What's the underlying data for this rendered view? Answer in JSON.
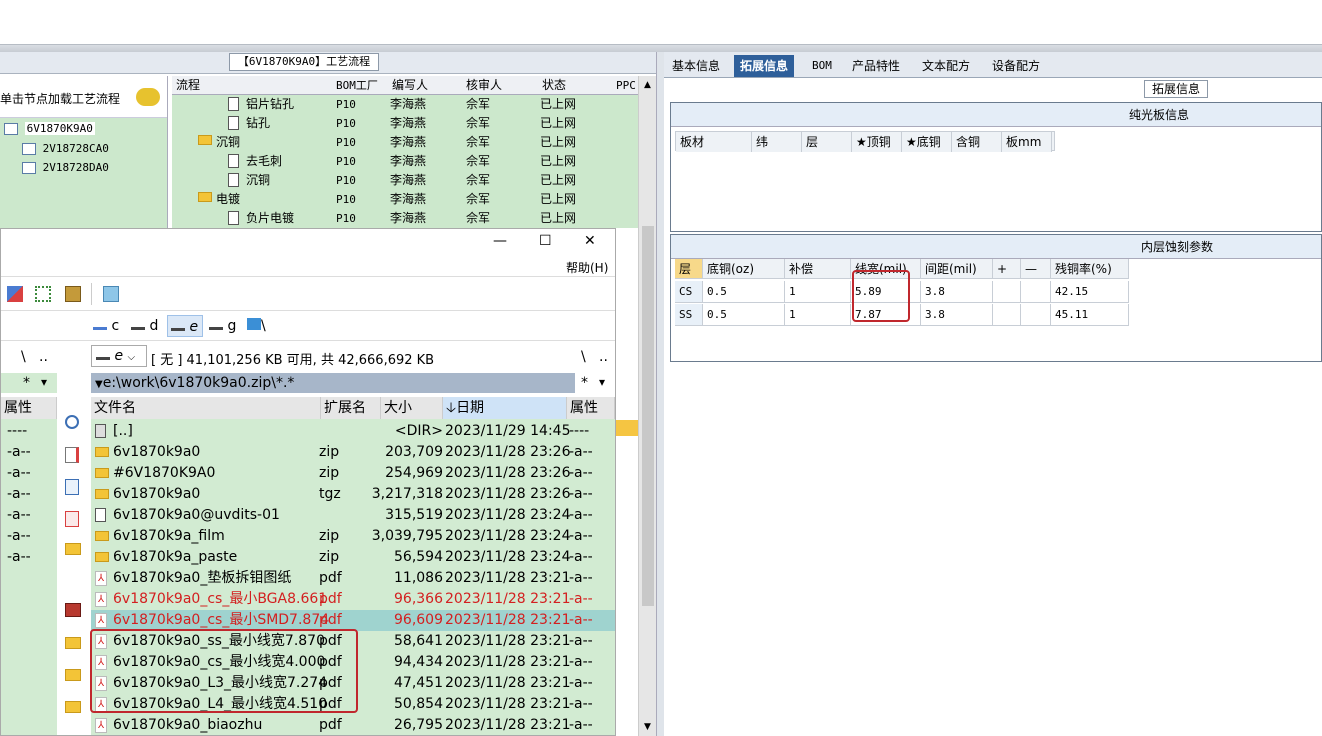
{
  "top_window": {
    "title": "【6V1870K9A0】工艺流程",
    "left_tree": {
      "hint": "单击节点加载工艺流程",
      "nodes": [
        "6V1870K9A0",
        "2V18728CA0",
        "2V18728DA0"
      ]
    },
    "process_headers": [
      "流程",
      "BOM工厂",
      "编写人",
      "核审人",
      "状态",
      "PPC"
    ],
    "process_rows": [
      {
        "name": "铝片钻孔",
        "bom": "P10",
        "writer": "李海燕",
        "reviewer": "佘军",
        "status": "已上网",
        "kind": "doc"
      },
      {
        "name": "钻孔",
        "bom": "P10",
        "writer": "李海燕",
        "reviewer": "佘军",
        "status": "已上网",
        "kind": "doc"
      },
      {
        "name": "沉铜",
        "bom": "P10",
        "writer": "李海燕",
        "reviewer": "佘军",
        "status": "已上网",
        "kind": "folder"
      },
      {
        "name": "去毛刺",
        "bom": "P10",
        "writer": "李海燕",
        "reviewer": "佘军",
        "status": "已上网",
        "kind": "doc"
      },
      {
        "name": "沉铜",
        "bom": "P10",
        "writer": "李海燕",
        "reviewer": "佘军",
        "status": "已上网",
        "kind": "doc"
      },
      {
        "name": "电镀",
        "bom": "P10",
        "writer": "李海燕",
        "reviewer": "佘军",
        "status": "已上网",
        "kind": "folder"
      },
      {
        "name": "负片电镀",
        "bom": "P10",
        "writer": "李海燕",
        "reviewer": "佘军",
        "status": "已上网",
        "kind": "doc"
      }
    ]
  },
  "tc": {
    "minimize": "—",
    "maximize": "☐",
    "close": "✕",
    "help_menu": "帮助(H)",
    "drives": [
      "c",
      "d",
      "e",
      "g",
      "\\"
    ],
    "left_path_a": "\\",
    "left_path_b": "..",
    "left_star": "*",
    "left_arrow": "▾",
    "drive_selected": "e",
    "free_space": "[ 无 ]  41,101,256 KB 可用, 共 42,666,692 KB",
    "right_path_a": "\\",
    "right_path_b": "..",
    "right_star": "*",
    "right_arrow": "▾",
    "path": "e:\\work\\6v1870k9a0.zip\\*.*",
    "left_attr_header": "属性",
    "left_attrs": [
      "----",
      "-a--",
      "-a--",
      "-a--",
      "-a--",
      "-a--",
      "-a--"
    ],
    "columns": {
      "name": "文件名",
      "ext": "扩展名",
      "size": "大小",
      "date": "日期",
      "attr": "属性"
    },
    "files": [
      {
        "name": "[..]",
        "ext": "",
        "size": "<DIR>",
        "date": "2023/11/29 14:45",
        "attr": "----",
        "icon": "up",
        "style": ""
      },
      {
        "name": "6v1870k9a0",
        "ext": "zip",
        "size": "203,709",
        "date": "2023/11/28 23:26",
        "attr": "-a--",
        "icon": "zip",
        "style": ""
      },
      {
        "name": "#6V1870K9A0",
        "ext": "zip",
        "size": "254,969",
        "date": "2023/11/28 23:26",
        "attr": "-a--",
        "icon": "zip",
        "style": ""
      },
      {
        "name": "6v1870k9a0",
        "ext": "tgz",
        "size": "3,217,318",
        "date": "2023/11/28 23:26",
        "attr": "-a--",
        "icon": "zip",
        "style": ""
      },
      {
        "name": "6v1870k9a0@uvdits-01",
        "ext": "",
        "size": "315,519",
        "date": "2023/11/28 23:24",
        "attr": "-a--",
        "icon": "doc",
        "style": ""
      },
      {
        "name": "6v1870k9a_film",
        "ext": "zip",
        "size": "3,039,795",
        "date": "2023/11/28 23:24",
        "attr": "-a--",
        "icon": "zip",
        "style": ""
      },
      {
        "name": "6v1870k9a_paste",
        "ext": "zip",
        "size": "56,594",
        "date": "2023/11/28 23:24",
        "attr": "-a--",
        "icon": "zip",
        "style": ""
      },
      {
        "name": "6v1870k9a0_垫板拆钼图纸",
        "ext": "pdf",
        "size": "11,086",
        "date": "2023/11/28 23:21",
        "attr": "-a--",
        "icon": "pdf",
        "style": ""
      },
      {
        "name": "6v1870k9a0_cs_最小BGA8.661",
        "ext": "pdf",
        "size": "96,366",
        "date": "2023/11/28 23:21",
        "attr": "-a--",
        "icon": "pdf",
        "style": "red"
      },
      {
        "name": "6v1870k9a0_cs_最小SMD7.874",
        "ext": "pdf",
        "size": "96,609",
        "date": "2023/11/28 23:21",
        "attr": "-a--",
        "icon": "pdf",
        "style": "red hl"
      },
      {
        "name": "6v1870k9a0_ss_最小线宽7.870",
        "ext": "pdf",
        "size": "58,641",
        "date": "2023/11/28 23:21",
        "attr": "-a--",
        "icon": "pdf",
        "style": ""
      },
      {
        "name": "6v1870k9a0_cs_最小线宽4.000",
        "ext": "pdf",
        "size": "94,434",
        "date": "2023/11/28 23:21",
        "attr": "-a--",
        "icon": "pdf",
        "style": ""
      },
      {
        "name": "6v1870k9a0_L3_最小线宽7.274",
        "ext": "pdf",
        "size": "47,451",
        "date": "2023/11/28 23:21",
        "attr": "-a--",
        "icon": "pdf",
        "style": ""
      },
      {
        "name": "6v1870k9a0_L4_最小线宽4.510",
        "ext": "pdf",
        "size": "50,854",
        "date": "2023/11/28 23:21",
        "attr": "-a--",
        "icon": "pdf",
        "style": ""
      },
      {
        "name": "6v1870k9a0_biaozhu",
        "ext": "pdf",
        "size": "26,795",
        "date": "2023/11/28 23:21",
        "attr": "-a--",
        "icon": "pdf",
        "style": ""
      }
    ]
  },
  "right_panel": {
    "tabs": [
      "基本信息",
      "拓展信息",
      "BOM",
      "产品特性",
      "文本配方",
      "设备配方"
    ],
    "active_tab": 1,
    "ext_label": "拓展信息",
    "bare_board": {
      "title": "纯光板信息",
      "headers": [
        "板材",
        "纬",
        "层",
        "★顶铜",
        "★底铜",
        "含铜",
        "板mm"
      ]
    },
    "etch": {
      "title": "内层蚀刻参数",
      "headers": [
        "层",
        "底铜(oz)",
        "补偿",
        "线宽(mil)",
        "间距(mil)",
        "+",
        "—",
        "残铜率(%)"
      ],
      "rows": [
        [
          "CS",
          "0.5",
          "1",
          "5.89",
          "3.8",
          "",
          "",
          "42.15"
        ],
        [
          "SS",
          "0.5",
          "1",
          "7.87",
          "3.8",
          "",
          "",
          "45.11"
        ]
      ]
    }
  },
  "colors": {
    "accent": "#2e5f9a",
    "grid_green": "#cce8cc",
    "highlight_red": "#c0272d",
    "selected_row": "#9fd3cf"
  }
}
